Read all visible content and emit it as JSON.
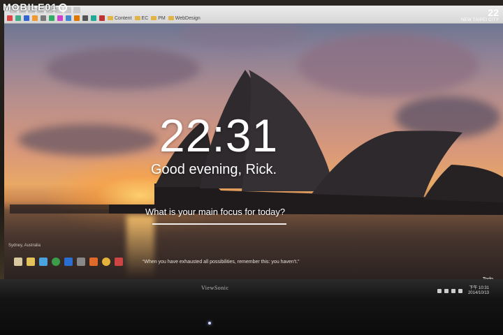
{
  "watermark": {
    "text": "MOBILE01"
  },
  "browser": {
    "bookmarks": [
      {
        "label": "Content",
        "icon": "folder-icon"
      },
      {
        "label": "EC",
        "icon": "folder-icon"
      },
      {
        "label": "PM",
        "icon": "folder-icon"
      },
      {
        "label": "WebDesign",
        "icon": "folder-icon"
      }
    ]
  },
  "weather": {
    "temperature": "22",
    "location": "NEW TAIPEI CITY"
  },
  "momentum": {
    "time": "22:31",
    "greeting": "Good evening, Rick.",
    "focus_question": "What is your main focus for today?",
    "focus_value": "",
    "quote": "“When you have exhausted all possibilities, remember this: you haven’t.”",
    "todo_label": "Todo",
    "photo_location": "Sydney, Australia"
  },
  "taskbar": {
    "tray_time": "下午 10:31",
    "tray_date": "2014/10/13"
  },
  "monitor": {
    "brand": "ViewSonic"
  },
  "colors": {
    "accent": "#ffffff",
    "sky_top": "#5b6f8e",
    "sunset": "#e8a866"
  }
}
